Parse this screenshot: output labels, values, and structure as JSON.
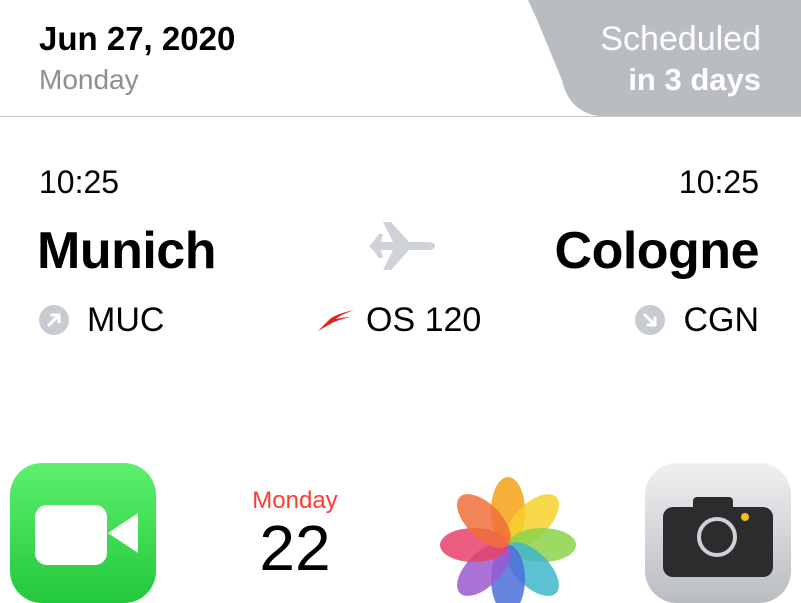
{
  "flight_card": {
    "date": "Jun 27, 2020",
    "weekday": "Monday",
    "status": {
      "line1": "Scheduled",
      "line2": "in 3 days",
      "background_color": "#b9bcc0"
    },
    "departure": {
      "time": "10:25",
      "city": "Munich",
      "code": "MUC",
      "icon": "departure-arrow-icon"
    },
    "arrival": {
      "time": "10:25",
      "city": "Cologne",
      "code": "CGN",
      "icon": "arrival-arrow-icon"
    },
    "flight_number": "OS 120",
    "airline_icon": "airline-logo-icon",
    "airline_color": "#e2231a",
    "plane_icon": "plane-icon",
    "plane_color": "#cfd2d6"
  },
  "dock": {
    "apps": [
      {
        "name": "FaceTime",
        "icon": "facetime-icon"
      },
      {
        "name": "Calendar",
        "icon": "calendar-icon",
        "day_label": "Monday",
        "date_number": "22"
      },
      {
        "name": "Photos",
        "icon": "photos-icon"
      },
      {
        "name": "Camera",
        "icon": "camera-icon"
      }
    ]
  }
}
